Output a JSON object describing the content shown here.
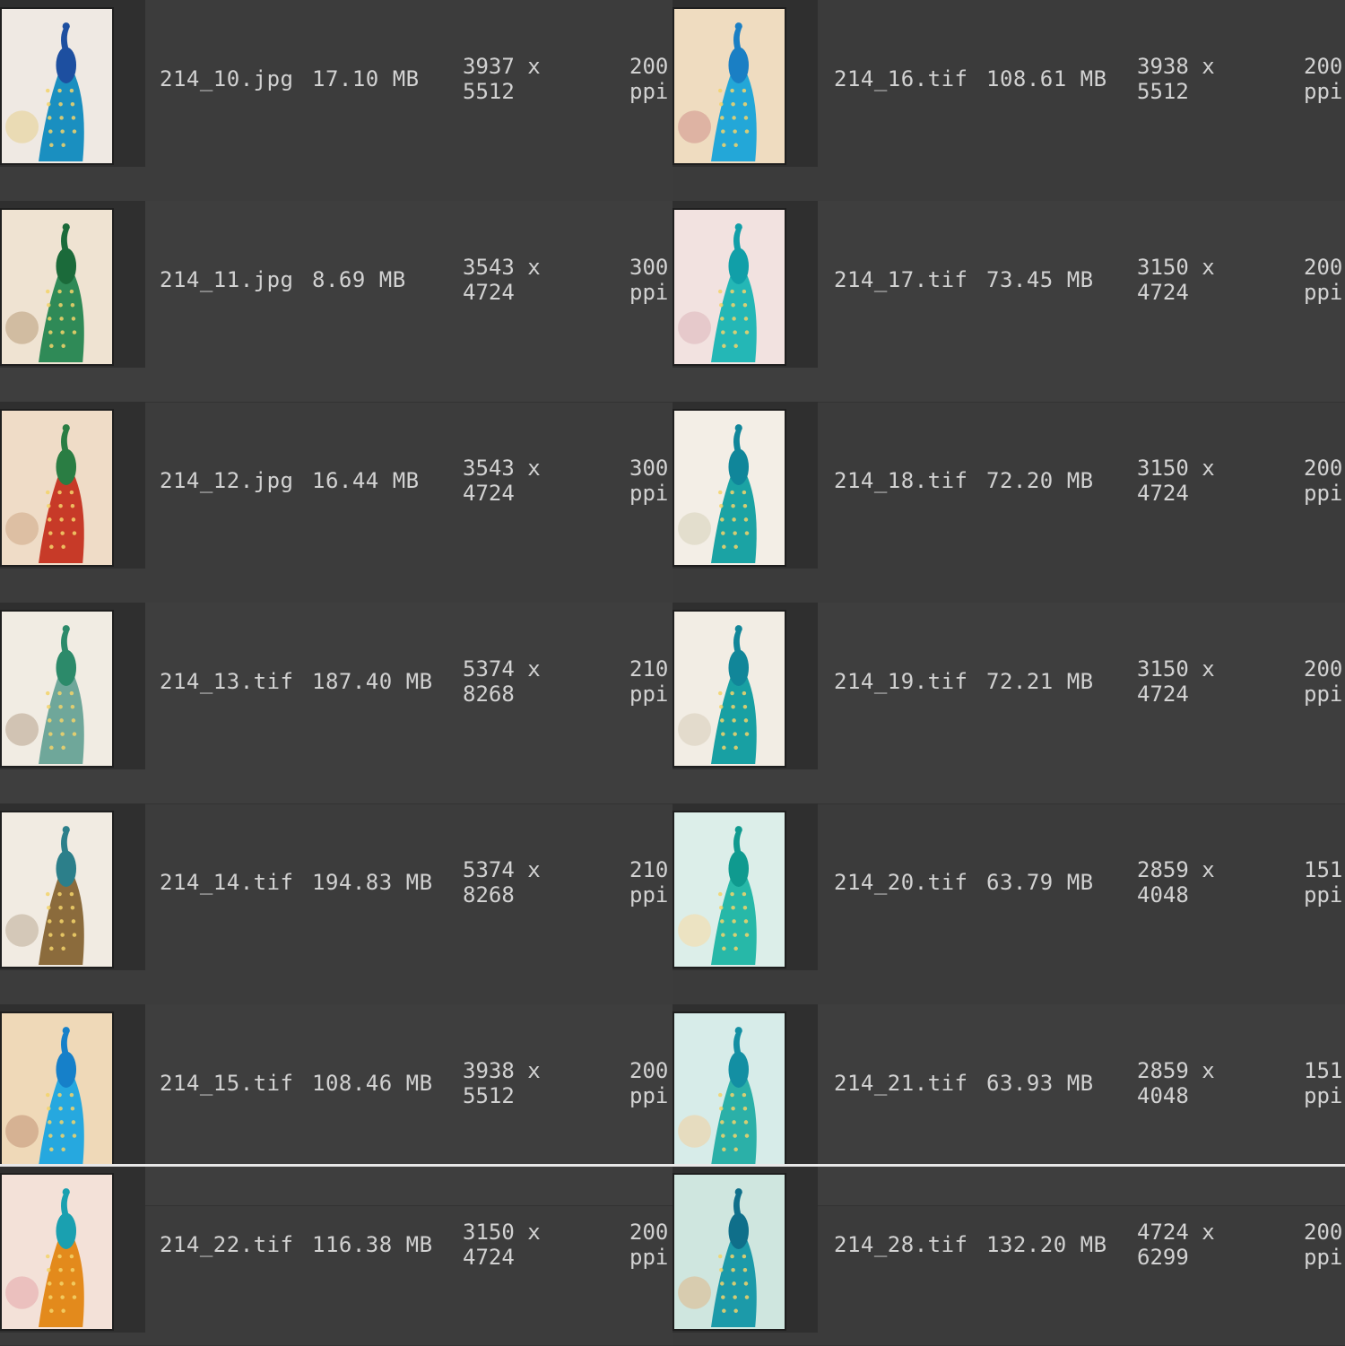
{
  "left_column": [
    {
      "filename": "214_10.jpg",
      "size": "17.10 MB",
      "dims_w": "3937 x",
      "dims_h": "5512",
      "res_val": "200",
      "res_unit": "ppi",
      "thumb_palette": [
        "#efe9e3",
        "#1d4fa0",
        "#1a8fc0",
        "#e9d7a8"
      ]
    },
    {
      "filename": "214_11.jpg",
      "size": "8.69 MB",
      "dims_w": "3543 x",
      "dims_h": "4724",
      "res_val": "300",
      "res_unit": "ppi",
      "thumb_palette": [
        "#efe3d2",
        "#1b6a3a",
        "#2f8a57",
        "#c9b295"
      ]
    },
    {
      "filename": "214_12.jpg",
      "size": "16.44 MB",
      "dims_w": "3543 x",
      "dims_h": "4724",
      "res_val": "300",
      "res_unit": "ppi",
      "thumb_palette": [
        "#efdcc7",
        "#2a7d43",
        "#c73a28",
        "#d8b89a"
      ]
    },
    {
      "filename": "214_13.tif",
      "size": "187.40 MB",
      "dims_w": "5374 x",
      "dims_h": "8268",
      "res_val": "210",
      "res_unit": "ppi",
      "thumb_palette": [
        "#f1ece3",
        "#2c8a6a",
        "#6fa79a",
        "#c9b9a6"
      ]
    },
    {
      "filename": "214_14.tif",
      "size": "194.83 MB",
      "dims_w": "5374 x",
      "dims_h": "8268",
      "res_val": "210",
      "res_unit": "ppi",
      "thumb_palette": [
        "#f1ebe2",
        "#2c7f8a",
        "#8b6b3c",
        "#cdbfae"
      ]
    },
    {
      "filename": "214_15.tif",
      "size": "108.46 MB",
      "dims_w": "3938 x",
      "dims_h": "5512",
      "res_val": "200",
      "res_unit": "ppi",
      "thumb_palette": [
        "#efd9b8",
        "#1680c9",
        "#26a8df",
        "#cfa88a"
      ]
    },
    {
      "filename": "214_22.tif",
      "size": "116.38 MB",
      "dims_w": "3150 x",
      "dims_h": "4724",
      "res_val": "200",
      "res_unit": "ppi",
      "thumb_palette": [
        "#f3e1d8",
        "#1aa0b0",
        "#e38a1c",
        "#e8b8b8"
      ]
    }
  ],
  "right_column": [
    {
      "filename": "214_16.tif",
      "size": "108.61 MB",
      "dims_w": "3938 x",
      "dims_h": "5512",
      "res_val": "200",
      "res_unit": "ppi",
      "thumb_palette": [
        "#efdcc0",
        "#1a7fc4",
        "#23a7d8",
        "#d9a99b"
      ]
    },
    {
      "filename": "214_17.tif",
      "size": "73.45 MB",
      "dims_w": "3150 x",
      "dims_h": "4724",
      "res_val": "200",
      "res_unit": "ppi",
      "thumb_palette": [
        "#f2e2e0",
        "#119fa8",
        "#24b7b6",
        "#e2c3c6"
      ]
    },
    {
      "filename": "214_18.tif",
      "size": "72.20 MB",
      "dims_w": "3150 x",
      "dims_h": "4724",
      "res_val": "200",
      "res_unit": "ppi",
      "thumb_palette": [
        "#f3eee6",
        "#10869a",
        "#1ba3a4",
        "#dedac7"
      ]
    },
    {
      "filename": "214_19.tif",
      "size": "72.21 MB",
      "dims_w": "3150 x",
      "dims_h": "4724",
      "res_val": "200",
      "res_unit": "ppi",
      "thumb_palette": [
        "#f2ede4",
        "#118699",
        "#18a0a3",
        "#dfd6c6"
      ]
    },
    {
      "filename": "214_20.tif",
      "size": "63.79 MB",
      "dims_w": "2859 x",
      "dims_h": "4048",
      "res_val": "151",
      "res_unit": "ppi",
      "thumb_palette": [
        "#dceee9",
        "#0f9a8f",
        "#27b8a8",
        "#f0e0b8"
      ]
    },
    {
      "filename": "214_21.tif",
      "size": "63.93 MB",
      "dims_w": "2859 x",
      "dims_h": "4048",
      "res_val": "151",
      "res_unit": "ppi",
      "thumb_palette": [
        "#d7ece9",
        "#138fa3",
        "#2bb0a8",
        "#ead8b4"
      ]
    },
    {
      "filename": "214_28.tif",
      "size": "132.20 MB",
      "dims_w": "4724 x",
      "dims_h": "6299",
      "res_val": "200",
      "res_unit": "ppi",
      "thumb_palette": [
        "#cfe6df",
        "#0f6f8a",
        "#1c9aa9",
        "#d9c6a3"
      ]
    }
  ]
}
